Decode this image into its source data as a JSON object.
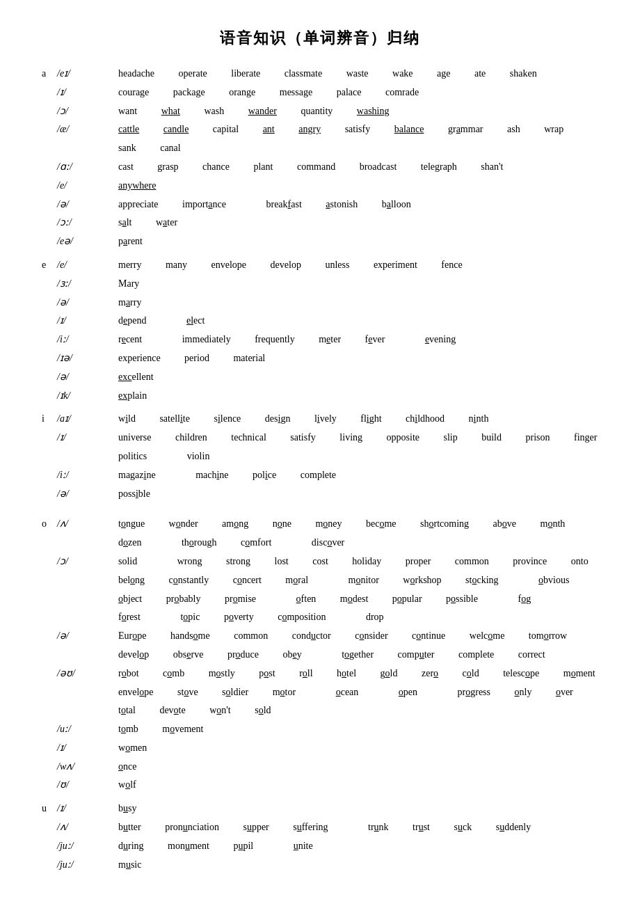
{
  "title": "语音知识（单词辨音）归纳",
  "sections": [
    {
      "id": "section-a",
      "letter": "a",
      "rows": [
        {
          "phoneme": "/eɪ/",
          "words": "headache  operate  liberate  classmate  waste  wake  age  ate  shaken"
        },
        {
          "phoneme": "/ɪ/",
          "indent": 1,
          "words": "courage  package  orange  message  palace  comrade"
        },
        {
          "phoneme": "/ɔ/",
          "indent": 1,
          "words": "want  what  wash  wander  quantity  washing"
        },
        {
          "phoneme": "/æ/",
          "indent": 1,
          "words": "cattle  candle  capital  ant  angry  satisfy  balance  grammar  ash  wrap"
        },
        {
          "phoneme": "",
          "indent": 2,
          "words": "sank  canal"
        },
        {
          "phoneme": "/ɑː/",
          "indent": 1,
          "words": "cast  grasp  chance  plant  command  broadcast  telegraph  shan't"
        },
        {
          "phoneme": "/e/",
          "indent": 1,
          "words": "anywhere"
        },
        {
          "phoneme": "/ə/",
          "indent": 1,
          "words": "appreciate  importance  breakfast  astonish  balloon"
        },
        {
          "phoneme": "/ɔː/",
          "indent": 1,
          "words": "salt  water"
        },
        {
          "phoneme": "/eə/",
          "indent": 1,
          "words": "parent"
        }
      ]
    },
    {
      "id": "section-e",
      "letter": "e",
      "rows": [
        {
          "phoneme": "/e/",
          "words": "merry  many  envelope  develop  unless  experiment  fence"
        },
        {
          "phoneme": "/ɜː/",
          "indent": 1,
          "words": "Mary"
        },
        {
          "phoneme": "/ə/",
          "indent": 1,
          "words": "marry"
        },
        {
          "phoneme": "/ɪ/",
          "indent": 1,
          "words": "depend  elect"
        },
        {
          "phoneme": "/iː/",
          "indent": 1,
          "words": "recent  immediately  frequently  meter  fever  evening"
        },
        {
          "phoneme": "/ɪə/",
          "indent": 0,
          "words": "experience  period  material"
        },
        {
          "phoneme": "/ə/",
          "indent": 0,
          "words": "excellent"
        },
        {
          "phoneme": "/ɪk/",
          "indent": 0,
          "words": "explain"
        }
      ]
    },
    {
      "id": "section-i",
      "letter": "i",
      "rows": [
        {
          "phoneme": "/aɪ/",
          "words": "wild  satellite  silence  design  lively  flight  childhood  ninth"
        },
        {
          "phoneme": "/ɪ/",
          "indent": 1,
          "words": "universe  children  technical  satisfy  living  opposite  slip  build  prison  finger"
        },
        {
          "phoneme": "",
          "indent": 2,
          "words": "politics  violin"
        },
        {
          "phoneme": "/iː/",
          "indent": 1,
          "words": "magazine  machine  police  complete"
        },
        {
          "phoneme": "/ə/",
          "indent": 0,
          "words": "possible"
        }
      ]
    },
    {
      "id": "section-o",
      "letter": "o",
      "emptyBefore": true,
      "rows": [
        {
          "phoneme": "/ʌ/",
          "words": "tongue  wonder  among  none  money  become  shortcoming  above  month"
        },
        {
          "phoneme": "",
          "indent": 2,
          "words": "dozen  thorough  comfort  discover"
        },
        {
          "phoneme": "/ɔ/",
          "indent": 1,
          "words": "solid  wrong  strong  lost  cost  holiday  proper  common  province  onto"
        },
        {
          "phoneme": "",
          "indent": 2,
          "words": "belong  constantly  concert  moral  monitor  workshop  stocking  obvious"
        },
        {
          "phoneme": "",
          "indent": 2,
          "words": "object  probably  promise  often  modest  popular  possible  fog"
        },
        {
          "phoneme": "",
          "indent": 2,
          "words": "forest  topic  poverty  composition  drop"
        },
        {
          "phoneme": "/ə/",
          "indent": 0,
          "words": "Europe  handsome  common  conductor  consider  continue  welcome  tomorrow"
        },
        {
          "phoneme": "",
          "indent": 2,
          "words": "develop  observe  produce  obey  together  computer  complete  correct"
        },
        {
          "phoneme": "/əʊ/",
          "indent": 1,
          "words": "robot  comb  mostly  post  roll  hotel  gold  zero  cold  telescope  moment"
        },
        {
          "phoneme": "",
          "indent": 2,
          "words": "envelope  stove  soldier  motor  ocean  open  progress  only  over"
        },
        {
          "phoneme": "",
          "indent": 2,
          "words": "total  devote  won't  sold"
        },
        {
          "phoneme": "/uː/",
          "indent": 1,
          "words": "tomb  movement"
        },
        {
          "phoneme": "/ɪ/",
          "indent": 1,
          "words": "women"
        },
        {
          "phoneme": "/wʌ/",
          "indent": 0,
          "words": "once"
        },
        {
          "phoneme": "/ʊ/",
          "indent": 1,
          "words": "wolf"
        }
      ]
    },
    {
      "id": "section-u",
      "letter": "u",
      "rows": [
        {
          "phoneme": "/ɪ/",
          "words": "busy"
        },
        {
          "phoneme": "/ʌ/",
          "indent": 0,
          "words": "butter  pronunciation  supper  suffering  trunk  trust  suck  suddenly"
        },
        {
          "phoneme": "/juː/",
          "indent": 1,
          "words": "during  monument  pupil  unite"
        },
        {
          "phoneme": "/juː/",
          "indent": 1,
          "words": "music"
        }
      ]
    }
  ]
}
